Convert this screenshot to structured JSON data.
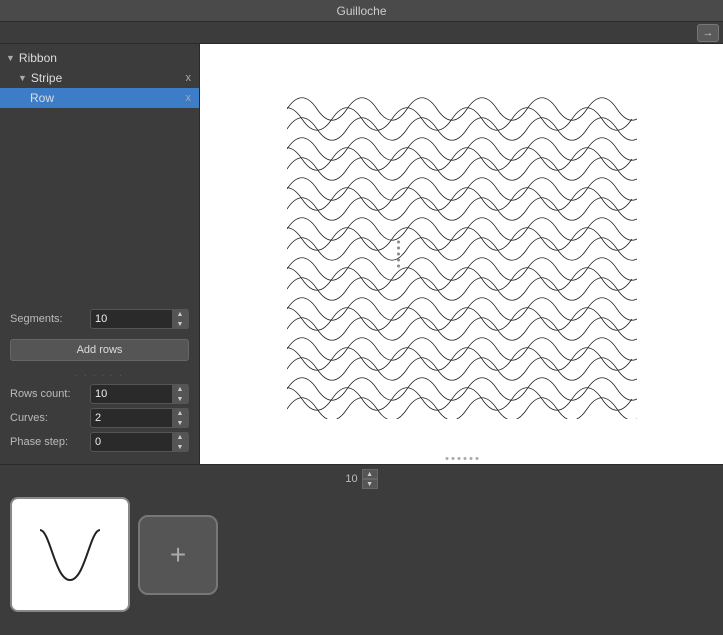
{
  "titleBar": {
    "title": "Guilloche"
  },
  "topBar": {
    "exportLabel": "→"
  },
  "leftPanel": {
    "tree": {
      "ribbon": {
        "label": "Ribbon",
        "stripe": {
          "label": "Stripe",
          "closeLabel": "x",
          "row": {
            "label": "Row",
            "closeLabel": "x"
          }
        }
      }
    },
    "segments": {
      "label": "Segments:",
      "value": "10"
    },
    "addRowsBtn": "Add rows",
    "rowsCount": {
      "label": "Rows count:",
      "value": "10"
    },
    "curves": {
      "label": "Curves:",
      "value": "2"
    },
    "phaseStep": {
      "label": "Phase step:",
      "value": "0"
    }
  },
  "bottomPanel": {
    "valueLabel": "10",
    "curves": [
      {
        "type": "v-curve"
      }
    ],
    "addCurveLabel": "+"
  },
  "dotDivider": "......",
  "sideDots": "......"
}
